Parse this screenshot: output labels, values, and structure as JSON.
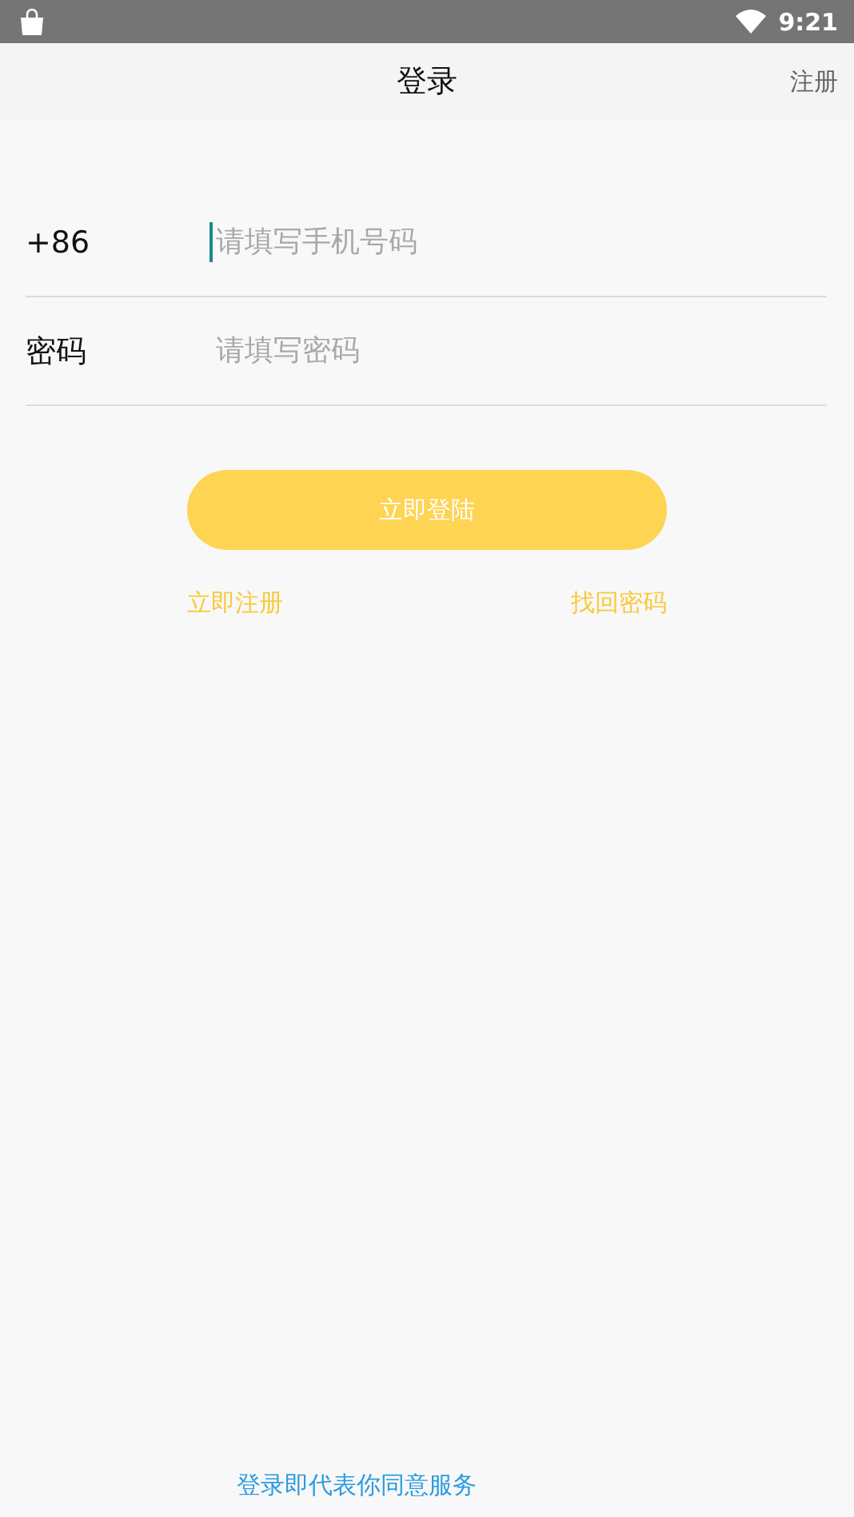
{
  "status_bar": {
    "time": "9:21"
  },
  "header": {
    "title": "登录",
    "action": "注册"
  },
  "fields": [
    {
      "label": "+86",
      "placeholder": "请填写手机号码",
      "focused": true
    },
    {
      "label": "密码",
      "placeholder": "请填写密码",
      "focused": false
    }
  ],
  "login_button": "立即登陆",
  "links": [
    "立即注册",
    "找回密码"
  ],
  "agreement": "登录即代表你同意服务"
}
